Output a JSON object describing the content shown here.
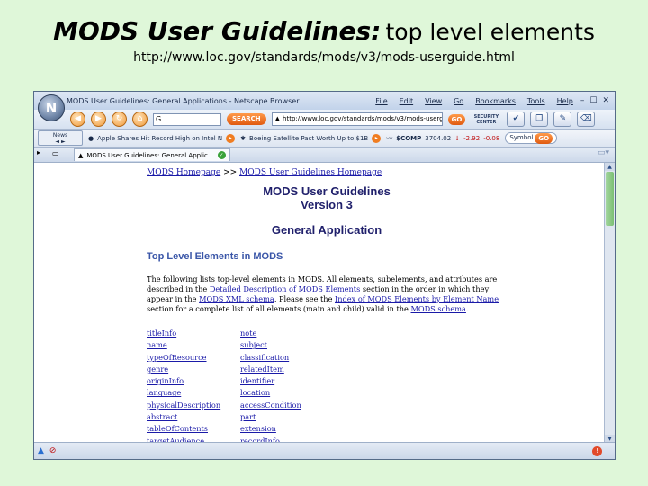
{
  "slide": {
    "title_main": "MODS User Guidelines:",
    "title_sub": "top level elements",
    "url": "http://www.loc.gov/standards/mods/v3/mods-userguide.html"
  },
  "browser": {
    "window_title": "MODS User Guidelines: General Applications - Netscape Browser",
    "logo_letter": "N",
    "menu": [
      "File",
      "Edit",
      "View",
      "Go",
      "Bookmarks",
      "Tools",
      "Help"
    ],
    "search": {
      "value": "G",
      "button": "SEARCH"
    },
    "address": "http://www.loc.gov/standards/mods/v3/mods-userguide",
    "go_label": "GO",
    "security_center": "SECURITY CENTER",
    "news_label": "News",
    "headlines": [
      "Apple Shares Hit Record High on Intel N",
      "Boeing Satellite Pact Worth Up to $1B"
    ],
    "stock": {
      "symbol": "$COMP",
      "value": "3704.02",
      "change": "-2.92",
      "pct": "-0.08"
    },
    "symbol_label": "Symbol",
    "tab_label": "MODS User Guidelines: General Applic..."
  },
  "page": {
    "crumb_home": "MODS Homepage",
    "crumb_sep": ">>",
    "crumb_guide": "MODS User Guidelines Homepage",
    "title_line1": "MODS User Guidelines",
    "title_line2": "Version 3",
    "subtitle": "General Application",
    "section_heading": "Top Level Elements in MODS",
    "para": {
      "t1": "The following lists top-level elements in MODS. All elements, subelements, and attributes are described in the ",
      "link1": "Detailed Description of MODS Elements",
      "t2": " section in the order in which they appear in the ",
      "link2": "MODS XML schema",
      "t3": ". Please see the ",
      "link3": "Index of MODS Elements by Element Name",
      "t4": " section for a complete list of all elements (main and child) valid in the ",
      "link4": "MODS schema",
      "t5": "."
    },
    "elements": [
      [
        "titleInfo",
        "note"
      ],
      [
        "name",
        "subject"
      ],
      [
        "typeOfResource",
        "classification"
      ],
      [
        "genre",
        "relatedItem"
      ],
      [
        "originInfo",
        "identifier"
      ],
      [
        "language",
        "location"
      ],
      [
        "physicalDescription",
        "accessCondition"
      ],
      [
        "abstract",
        "part"
      ],
      [
        "tableOfContents",
        "extension"
      ],
      [
        "targetAudience",
        "recordInfo"
      ]
    ]
  }
}
